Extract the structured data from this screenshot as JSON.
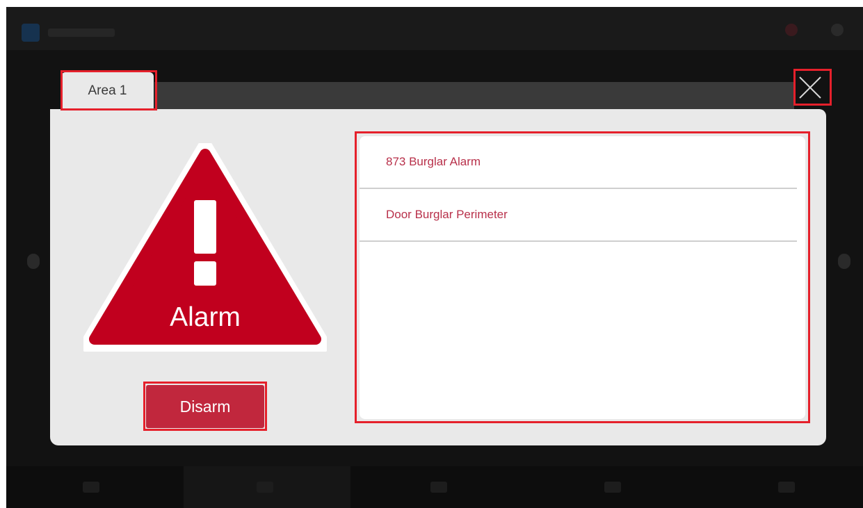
{
  "modal": {
    "area_tab": "Area 1",
    "status_label": "Alarm",
    "disarm_label": "Disarm",
    "events": [
      {
        "label": "873 Burglar Alarm"
      },
      {
        "label": "Door Burglar Perimeter"
      }
    ]
  },
  "icons": {
    "close": "close-icon",
    "alarm": "warning-triangle-icon"
  },
  "colors": {
    "alarm_red": "#c1001e",
    "button_red": "#c1273d",
    "event_text": "#b8304a",
    "annotation": "#e5202b",
    "panel_bg": "#e9e9e9"
  }
}
